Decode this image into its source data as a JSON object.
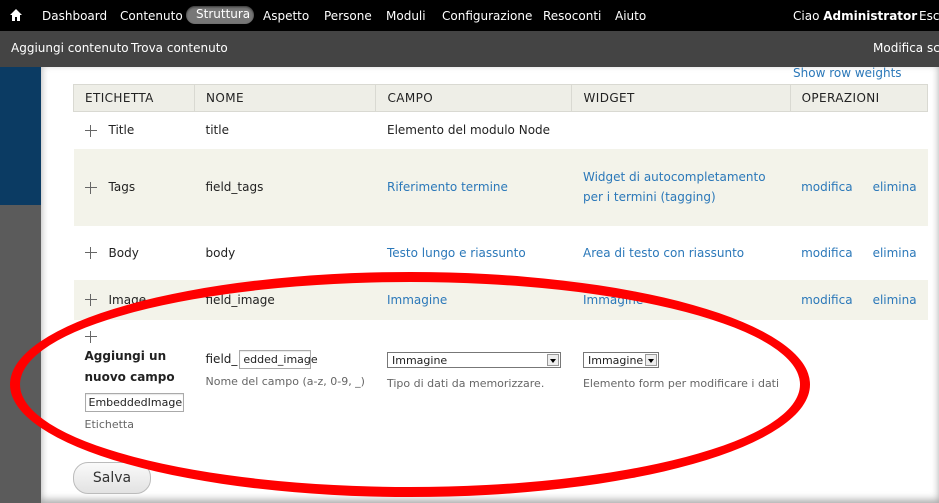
{
  "toolbar": {
    "items": [
      "Dashboard",
      "Contenuto",
      "Struttura",
      "Aspetto",
      "Persone",
      "Moduli",
      "Configurazione",
      "Resoconti",
      "Aiuto"
    ],
    "greeting": "Ciao",
    "user": "Administrator",
    "logout": "Esci"
  },
  "shortcuts": {
    "add_content": "Aggiungi contenuto",
    "find_content": "Trova contenuto",
    "edit_shortcuts": "Modifica sco"
  },
  "table": {
    "show_row_weights": "Show row weights",
    "headers": [
      "ETICHETTA",
      "NOME",
      "CAMPO",
      "WIDGET",
      "OPERAZIONI"
    ],
    "rows": [
      {
        "label": "Title",
        "name": "title",
        "field": "Elemento del modulo Node",
        "widget": "",
        "edit": "",
        "delete": ""
      },
      {
        "label": "Tags",
        "name": "field_tags",
        "field": "Riferimento termine",
        "widget": "Widget di autocompletamento per i termini (tagging)",
        "edit": "modifica",
        "delete": "elimina"
      },
      {
        "label": "Body",
        "name": "body",
        "field": "Testo lungo e riassunto",
        "widget": "Area di testo con riassunto",
        "edit": "modifica",
        "delete": "elimina"
      },
      {
        "label": "Image",
        "name": "field_image",
        "field": "Immagine",
        "widget": "Immagine",
        "edit": "modifica",
        "delete": "elimina"
      }
    ],
    "new_field": {
      "title": "Aggiungi un nuovo campo",
      "label_value": "EmbeddedImage",
      "label_caption": "Etichetta",
      "name_prefix": "field_",
      "name_value": "edded_image",
      "name_desc": "Nome del campo (a-z, 0-9, _)",
      "type_value": "Immagine",
      "type_desc": "Tipo di dati da memorizzare.",
      "widget_value": "Immagine",
      "widget_desc": "Elemento form per modificare i dati"
    }
  },
  "save_label": "Salva",
  "colors": {
    "toolbar": "#000000",
    "link": "#2b78b9",
    "annotation": "#ff0000"
  }
}
